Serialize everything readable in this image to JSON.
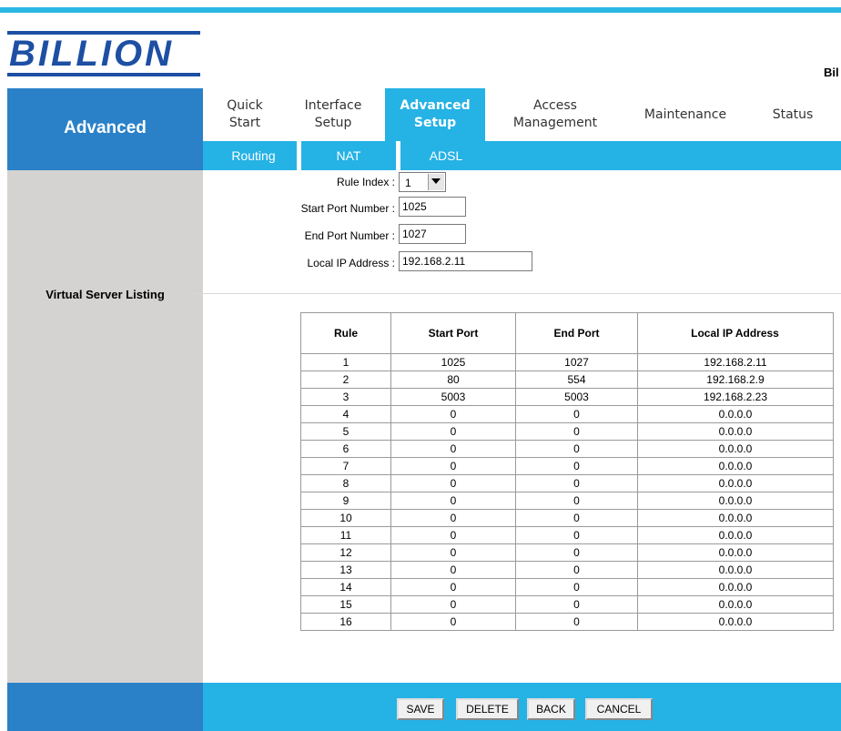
{
  "header": {
    "logo_text": "BILLION",
    "brand_right": "Bil"
  },
  "sidebar": {
    "section_label": "Advanced",
    "listing_label": "Virtual Server Listing"
  },
  "nav": {
    "main": [
      {
        "line1": "Quick",
        "line2": "Start"
      },
      {
        "line1": "Interface",
        "line2": "Setup"
      },
      {
        "line1": "Advanced",
        "line2": "Setup",
        "active": true
      },
      {
        "line1": "Access",
        "line2": "Management"
      },
      {
        "line1": "Maintenance",
        "line2": ""
      },
      {
        "line1": "Status",
        "line2": ""
      }
    ],
    "sub": [
      "Routing",
      "NAT",
      "ADSL"
    ]
  },
  "form": {
    "rule_index_label": "Rule Index :",
    "rule_index_value": "1",
    "start_port_label": "Start Port Number :",
    "start_port_value": "1025",
    "end_port_label": "End Port Number :",
    "end_port_value": "1027",
    "local_ip_label": "Local IP Address :",
    "local_ip_value": "192.168.2.11"
  },
  "table": {
    "headers": [
      "Rule",
      "Start Port",
      "End Port",
      "Local IP Address"
    ],
    "rows": [
      [
        "1",
        "1025",
        "1027",
        "192.168.2.11"
      ],
      [
        "2",
        "80",
        "554",
        "192.168.2.9"
      ],
      [
        "3",
        "5003",
        "5003",
        "192.168.2.23"
      ],
      [
        "4",
        "0",
        "0",
        "0.0.0.0"
      ],
      [
        "5",
        "0",
        "0",
        "0.0.0.0"
      ],
      [
        "6",
        "0",
        "0",
        "0.0.0.0"
      ],
      [
        "7",
        "0",
        "0",
        "0.0.0.0"
      ],
      [
        "8",
        "0",
        "0",
        "0.0.0.0"
      ],
      [
        "9",
        "0",
        "0",
        "0.0.0.0"
      ],
      [
        "10",
        "0",
        "0",
        "0.0.0.0"
      ],
      [
        "11",
        "0",
        "0",
        "0.0.0.0"
      ],
      [
        "12",
        "0",
        "0",
        "0.0.0.0"
      ],
      [
        "13",
        "0",
        "0",
        "0.0.0.0"
      ],
      [
        "14",
        "0",
        "0",
        "0.0.0.0"
      ],
      [
        "15",
        "0",
        "0",
        "0.0.0.0"
      ],
      [
        "16",
        "0",
        "0",
        "0.0.0.0"
      ]
    ]
  },
  "buttons": {
    "save": "SAVE",
    "delete": "DELETE",
    "back": "BACK",
    "cancel": "CANCEL"
  },
  "colors": {
    "accent": "#25b2e5",
    "sidebar_blue": "#2a81c8",
    "logo_blue": "#1d4fa3",
    "sidebar_gray": "#d4d3d1"
  }
}
